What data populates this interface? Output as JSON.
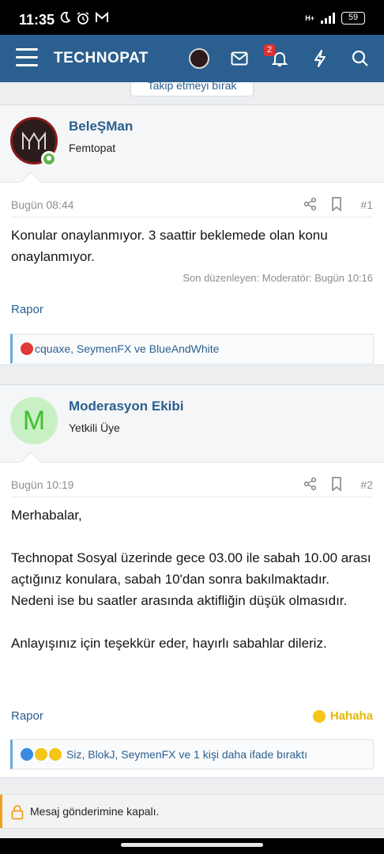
{
  "status_bar": {
    "time": "11:35",
    "icons": [
      "moon-icon",
      "alarm-icon",
      "gmail-icon"
    ],
    "network": "H+",
    "battery": "59"
  },
  "header": {
    "logo": "TECHNOPAT",
    "notification_count": "2",
    "accent_color": "#2a5f8f"
  },
  "follow_button": "Takip etmeyi bırak",
  "posts": [
    {
      "username": "BeleŞMan",
      "user_title": "Femtopat",
      "date": "Bugün 08:44",
      "number": "#1",
      "body": "Konular onaylanmıyor. 3 saattir beklemede olan konu onaylanmıyor.",
      "edited": "Son düzenleyen: Moderatör: Bugün 10:16",
      "report": "Rapor",
      "reactions": "cquaxe, SeymenFX ve BlueAndWhite"
    },
    {
      "username": "Moderasyon Ekibi",
      "avatar_letter": "M",
      "user_title": "Yetkili Üye",
      "date": "Bugün 10:19",
      "number": "#2",
      "body_lines": [
        "Merhabalar,",
        "Technopat Sosyal üzerinde gece 03.00 ile sabah 10.00 arası açtığınız konulara, sabah 10'dan sonra bakılmaktadır.",
        "Nedeni ise bu saatler arasında aktifliğin düşük olmasıdır.",
        "Anlayışınız için teşekkür eder, hayırlı sabahlar dileriz."
      ],
      "report": "Rapor",
      "reaction_label": "Hahaha",
      "reactions": "Siz, BlokJ, SeymenFX ve 1 kişi daha ifade bıraktı"
    }
  ],
  "closed_notice": "Mesaj gönderimine kapalı."
}
